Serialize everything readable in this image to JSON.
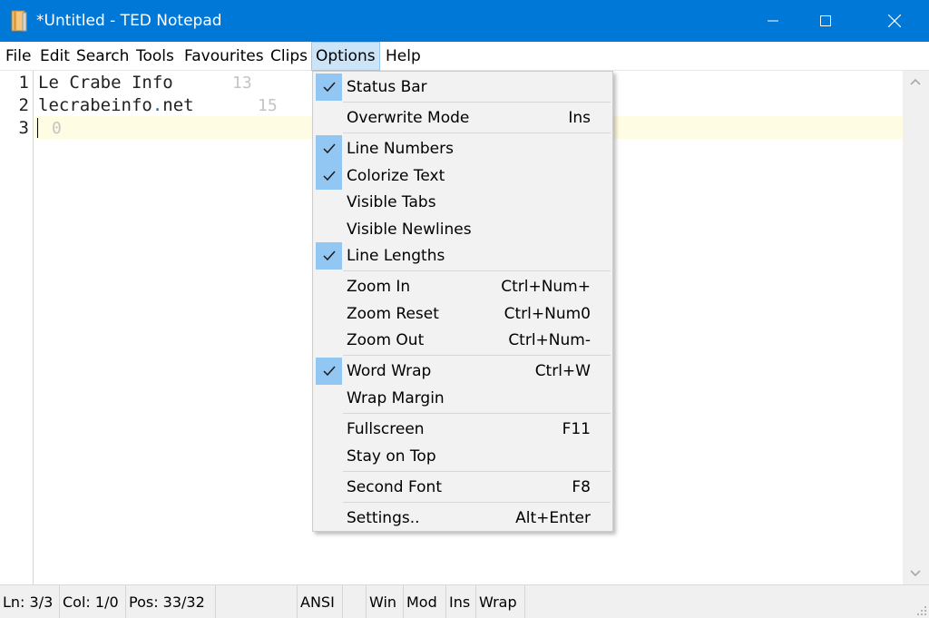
{
  "window": {
    "title": "*Untitled - TED Notepad",
    "accent": "#0078d7"
  },
  "menubar": {
    "items": [
      "File",
      "Edit",
      "Search",
      "Tools",
      "Favourites",
      "Clips",
      "Options",
      "Help"
    ],
    "active": "Options"
  },
  "editor": {
    "lines": [
      {
        "number": "1",
        "text": "Le Crabe Info",
        "length": "13"
      },
      {
        "number": "2",
        "text_before_dot": "lecrabeinfo",
        "text_dot": ".",
        "text_after_dot": "net",
        "length": "15"
      },
      {
        "number": "3",
        "text": "",
        "length": "0"
      }
    ],
    "current_line_color": "#fefce2"
  },
  "options_menu": {
    "items": [
      {
        "label": "Status Bar",
        "checked": true,
        "shortcut": ""
      },
      {
        "label": "Overwrite Mode",
        "checked": false,
        "shortcut": "Ins"
      },
      {
        "label": "Line Numbers",
        "checked": true,
        "shortcut": ""
      },
      {
        "label": "Colorize Text",
        "checked": true,
        "shortcut": ""
      },
      {
        "label": "Visible Tabs",
        "checked": false,
        "shortcut": ""
      },
      {
        "label": "Visible Newlines",
        "checked": false,
        "shortcut": ""
      },
      {
        "label": "Line Lengths",
        "checked": true,
        "shortcut": ""
      },
      {
        "label": "Zoom In",
        "checked": false,
        "shortcut": "Ctrl+Num+"
      },
      {
        "label": "Zoom Reset",
        "checked": false,
        "shortcut": "Ctrl+Num0"
      },
      {
        "label": "Zoom Out",
        "checked": false,
        "shortcut": "Ctrl+Num-"
      },
      {
        "label": "Word Wrap",
        "checked": true,
        "shortcut": "Ctrl+W"
      },
      {
        "label": "Wrap Margin",
        "checked": false,
        "shortcut": ""
      },
      {
        "label": "Fullscreen",
        "checked": false,
        "shortcut": "F11"
      },
      {
        "label": "Stay on Top",
        "checked": false,
        "shortcut": ""
      },
      {
        "label": "Second Font",
        "checked": false,
        "shortcut": "F8"
      },
      {
        "label": "Settings..",
        "checked": false,
        "shortcut": "Alt+Enter"
      }
    ],
    "check_color": "#92c6f3"
  },
  "statusbar": {
    "line": "Ln: 3/3",
    "column": "Col: 1/0",
    "position": "Pos: 33/32",
    "encoding": "ANSI",
    "newline": "Win",
    "modified": "Mod",
    "insert": "Ins",
    "wrap": "Wrap"
  },
  "icons": {
    "app": "notepad-app-icon",
    "minimize": "minimize-icon",
    "maximize": "maximize-icon",
    "close": "close-icon",
    "check": "checkmark-icon",
    "scroll_up": "chevron-up-icon",
    "scroll_down": "chevron-down-icon",
    "grip": "resize-grip-icon"
  }
}
